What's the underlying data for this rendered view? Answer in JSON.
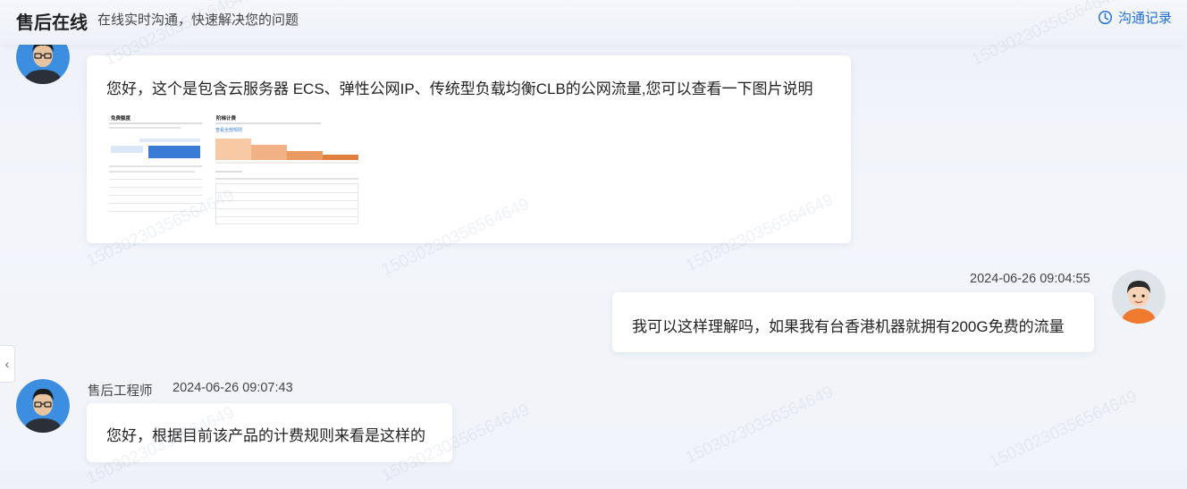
{
  "header": {
    "title": "售后在线",
    "subtitle": "在线实时沟通，快速解决您的问题",
    "history_label": "沟通记录"
  },
  "messages": [
    {
      "side": "left",
      "text": "您好，这个是包含云服务器 ECS、弹性公网IP、传统型负载均衡CLB的公网流量,您可以查看一下图片说明",
      "image": {
        "left_title": "免费额度",
        "right_title": "阶梯计费",
        "right_link": "查看全部规则"
      }
    },
    {
      "side": "right",
      "timestamp": "2024-06-26 09:04:55",
      "text": "我可以这样理解吗，如果我有台香港机器就拥有200G免费的流量"
    },
    {
      "side": "left",
      "sender": "售后工程师",
      "timestamp": "2024-06-26 09:07:43",
      "text": "您好，根据目前该产品的计费规则来看是这样的"
    }
  ],
  "watermark": "15030230356564649",
  "colors": {
    "accent": "#1f6fd6",
    "bar_orange": "#f0a06a",
    "bar_blue": "#3a7bd5"
  }
}
